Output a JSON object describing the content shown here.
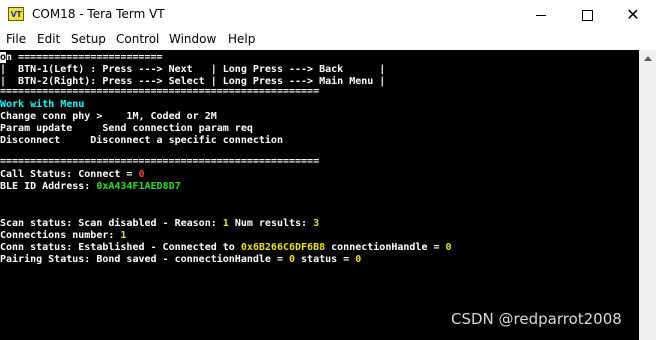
{
  "window": {
    "app_icon_text": "VT",
    "title": "COM18 - Tera Term VT",
    "minimize_glyph": "—",
    "close_glyph": "✕"
  },
  "menu": {
    "items": [
      "File",
      "Edit",
      "Setup",
      "Control",
      "Window",
      "Help"
    ]
  },
  "terminal": {
    "cursor_char": "o",
    "border_top": "n ========================",
    "btn1_line": "|  BTN-1(Left) : Press ---> Next   | Long Press ---> Back      |",
    "btn2_line": "|  BTN-2(Right): Press ---> Select | Long Press ---> Main Menu |",
    "border_bottom": "=====================================================",
    "menu_heading": "Work with Menu",
    "menu_items": [
      "Change conn phy >    1M, Coded or 2M",
      "Param update     Send connection param req",
      "Disconnect     Disconnect a specific connection"
    ],
    "border_mid": "=====================================================",
    "call_status_label": "Call Status: Connect = ",
    "call_status_value": "0",
    "ble_id_label": "BLE ID Address: ",
    "ble_id_value": "0xA434F1AED8D7",
    "scan_status": {
      "prefix": "Scan status: Scan disabled - Reason: ",
      "reason": "1",
      "mid": " Num results: ",
      "num_results": "3"
    },
    "connections": {
      "label": "Connections number: ",
      "value": "1"
    },
    "conn_status": {
      "prefix": "Conn status: Established - Connected to ",
      "address": "0x6B266C6DF6B8",
      "mid": " connectionHandle = ",
      "handle": "0"
    },
    "pairing_status": {
      "prefix": "Pairing Status: Bond saved - connectionHandle = ",
      "handle": "0",
      "mid": " status = ",
      "status": "0"
    }
  },
  "watermark": "CSDN @redparrot2008",
  "colors": {
    "terminal_bg": "#000000",
    "text": "#ffffff",
    "heading": "#00ffff",
    "value_red": "#ff3b3b",
    "value_green": "#22dd22",
    "value_yellow": "#e8e000"
  }
}
